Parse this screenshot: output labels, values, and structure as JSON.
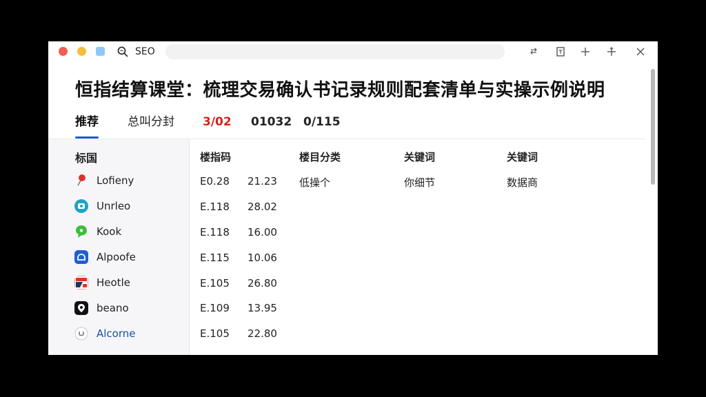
{
  "window": {
    "app_title": "SEO",
    "address_value": ""
  },
  "toolbar": {
    "icons": [
      "swap-icon",
      "bookmark-icon",
      "plus-icon",
      "move-icon",
      "close-icon"
    ]
  },
  "page": {
    "title": "恒指结算课堂：梳理交易确认书记录规则配套清单与实操示例说明"
  },
  "tabs": [
    {
      "label": "推荐"
    },
    {
      "label": "总叫分封"
    },
    {
      "label": "3/02"
    },
    {
      "label": "01032"
    },
    {
      "label": "0/115"
    }
  ],
  "sidebar": {
    "heading": "标国",
    "items": [
      {
        "label": "Lofieny",
        "icon": "pin-icon"
      },
      {
        "label": "Unrleo",
        "icon": "video-app-icon"
      },
      {
        "label": "Kook",
        "icon": "chat-bubble-icon"
      },
      {
        "label": "Alpoofe",
        "icon": "cloud-app-icon"
      },
      {
        "label": "Heotle",
        "icon": "flag-app-icon"
      },
      {
        "label": "beano",
        "icon": "location-app-icon"
      },
      {
        "label": "Alcorne",
        "icon": "circle-logo-icon"
      }
    ]
  },
  "table": {
    "headers": [
      "楼指码",
      "楼目分类",
      "关键词",
      "关键词"
    ],
    "rows": [
      {
        "code": "E0.28",
        "value": "21.23",
        "category": "低操个",
        "keyword1": "你细节",
        "keyword2": "数据商"
      },
      {
        "code": "E.118",
        "value": "28.02",
        "category": "",
        "keyword1": "",
        "keyword2": ""
      },
      {
        "code": "E.118",
        "value": "16.00",
        "category": "",
        "keyword1": "",
        "keyword2": ""
      },
      {
        "code": "E.115",
        "value": "10.06",
        "category": "",
        "keyword1": "",
        "keyword2": ""
      },
      {
        "code": "E.105",
        "value": "26.80",
        "category": "",
        "keyword1": "",
        "keyword2": ""
      },
      {
        "code": "E.109",
        "value": "13.95",
        "category": "",
        "keyword1": "",
        "keyword2": ""
      },
      {
        "code": "E.105",
        "value": "22.80",
        "category": "",
        "keyword1": "",
        "keyword2": ""
      }
    ]
  },
  "colors": {
    "accent": "#1a5fd0",
    "highlight_red": "#d4231c",
    "sidebar_bg": "#f6f6f8"
  }
}
